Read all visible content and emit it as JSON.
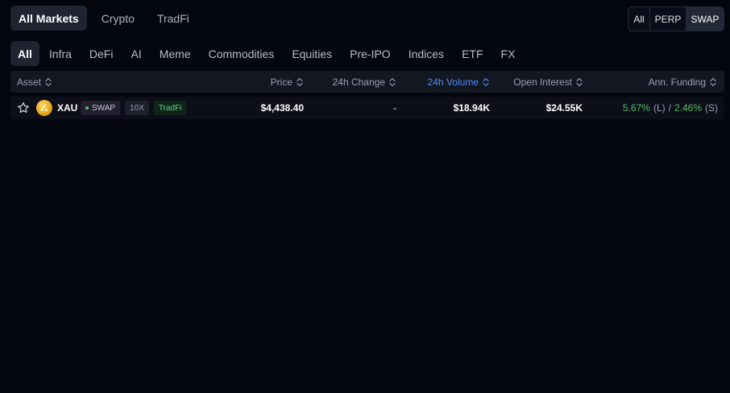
{
  "top_tabs": [
    {
      "label": "All Markets",
      "active": true
    },
    {
      "label": "Crypto",
      "active": false
    },
    {
      "label": "TradFi",
      "active": false
    }
  ],
  "type_filter": {
    "options": [
      {
        "label": "All",
        "active": false
      },
      {
        "label": "PERP",
        "active": false
      },
      {
        "label": "SWAP",
        "active": true
      }
    ]
  },
  "categories": [
    {
      "label": "All",
      "active": true
    },
    {
      "label": "Infra"
    },
    {
      "label": "DeFi"
    },
    {
      "label": "AI"
    },
    {
      "label": "Meme"
    },
    {
      "label": "Commodities"
    },
    {
      "label": "Equities"
    },
    {
      "label": "Pre-IPO"
    },
    {
      "label": "Indices"
    },
    {
      "label": "ETF"
    },
    {
      "label": "FX"
    }
  ],
  "table": {
    "columns": {
      "asset": "Asset",
      "price": "Price",
      "change": "24h Change",
      "volume": "24h Volume",
      "oi": "Open Interest",
      "funding": "Ann. Funding"
    },
    "sorted_column": "volume",
    "rows": [
      {
        "symbol": "XAU",
        "type_badge": "SWAP",
        "leverage": "10X",
        "sector": "TradFi",
        "price": "$4,438.40",
        "change": "-",
        "volume": "$18.94K",
        "open_interest": "$24.55K",
        "funding_long": "5.67%",
        "funding_long_label": "(L)",
        "funding_sep": "/",
        "funding_short": "2.46%",
        "funding_short_label": "(S)"
      }
    ]
  },
  "colors": {
    "background": "#04060f",
    "accent_blue": "#4f8ef7",
    "positive_green": "#4ec05e",
    "gold": "#e8a91d"
  },
  "icons": {
    "favorite": "star-outline-icon",
    "asset": "gold-coin-icon",
    "sort": "sort-updown-icon"
  }
}
